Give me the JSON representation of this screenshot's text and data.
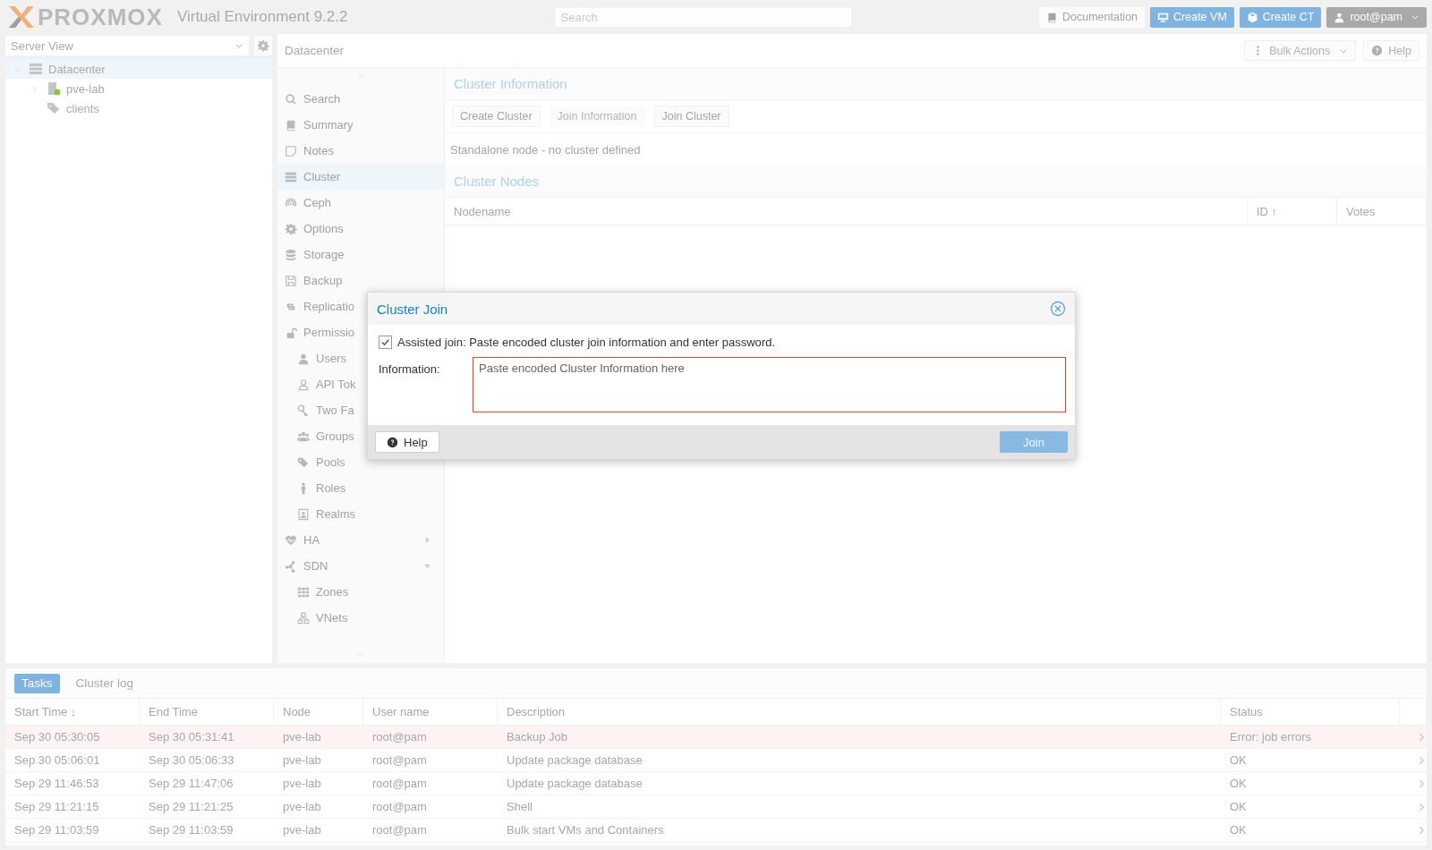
{
  "topbar": {
    "logo": "PROXMOX",
    "version": "Virtual Environment 9.2.2",
    "search": {
      "placeholder": "Search"
    },
    "buttons": [
      {
        "label": "Documentation",
        "kind": "plain"
      },
      {
        "label": "Create VM",
        "kind": "primary"
      },
      {
        "label": "Create CT",
        "kind": "primary"
      },
      {
        "label": "root@pam",
        "kind": "user"
      }
    ]
  },
  "sidebar": {
    "view_selector": "Server View",
    "tree": [
      {
        "label": "Datacenter",
        "selected": true,
        "expanded": true,
        "children": [
          {
            "label": "pve-lab",
            "selected": false,
            "expanded": false
          },
          {
            "label": "clients",
            "selected": false
          }
        ]
      }
    ]
  },
  "content": {
    "title": "Datacenter",
    "header_buttons": [
      {
        "label": "Bulk Actions",
        "menu": true
      },
      {
        "label": "Help",
        "menu": false
      }
    ],
    "nav": [
      {
        "label": "Search",
        "selected": false
      },
      {
        "label": "Summary",
        "selected": false
      },
      {
        "label": "Notes",
        "selected": false
      },
      {
        "label": "Cluster",
        "selected": true
      },
      {
        "label": "Ceph",
        "selected": false
      },
      {
        "label": "Options",
        "selected": false
      },
      {
        "label": "Storage",
        "selected": false
      },
      {
        "label": "Backup",
        "selected": false
      },
      {
        "label": "Replicatio",
        "selected": false
      },
      {
        "label": "Permissio",
        "selected": false,
        "children": [
          {
            "label": "Users",
            "selected": false
          },
          {
            "label": "API Tok",
            "selected": false
          },
          {
            "label": "Two Fa",
            "selected": false
          },
          {
            "label": "Groups",
            "selected": false
          },
          {
            "label": "Pools",
            "selected": false
          },
          {
            "label": "Roles",
            "selected": false
          },
          {
            "label": "Realms",
            "selected": false
          }
        ]
      },
      {
        "label": "HA",
        "selected": false,
        "expanded": false
      },
      {
        "label": "SDN",
        "selected": false,
        "expanded": true,
        "children": [
          {
            "label": "Zones",
            "selected": false
          },
          {
            "label": "VNets",
            "selected": false
          }
        ]
      }
    ],
    "cluster_information": {
      "title": "Cluster Information",
      "buttons": [
        {
          "label": "Create Cluster",
          "disabled": false
        },
        {
          "label": "Join Information",
          "disabled": true
        },
        {
          "label": "Join Cluster",
          "disabled": false
        }
      ],
      "status": "Standalone node - no cluster defined"
    },
    "cluster_nodes": {
      "title": "Cluster Nodes",
      "columns": [
        "Nodename",
        "ID ↑",
        "Votes"
      ]
    }
  },
  "dialog": {
    "title": "Cluster Join",
    "assisted_join": {
      "label": "Assisted join: Paste encoded cluster join information and enter password.",
      "checked": true
    },
    "information": {
      "label": "Information:",
      "placeholder": "Paste encoded Cluster Information here",
      "invalid": true
    },
    "help_button": "Help",
    "join_button": {
      "label": "Join",
      "disabled": true
    }
  },
  "tasks": {
    "tabs": [
      {
        "label": "Tasks",
        "selected": true
      },
      {
        "label": "Cluster log",
        "selected": false
      }
    ],
    "columns": [
      "Start Time ↓",
      "End Time",
      "Node",
      "User name",
      "Description",
      "Status"
    ],
    "rows": [
      {
        "cells": [
          "Sep 30 05:30:05",
          "Sep 30 05:31:41",
          "pve-lab",
          "root@pam",
          "Backup Job",
          "Error: job errors"
        ],
        "error": true
      },
      {
        "cells": [
          "Sep 30 05:06:01",
          "Sep 30 05:06:33",
          "pve-lab",
          "root@pam",
          "Update package database",
          "OK"
        ],
        "error": false
      },
      {
        "cells": [
          "Sep 29 11:46:53",
          "Sep 29 11:47:06",
          "pve-lab",
          "root@pam",
          "Update package database",
          "OK"
        ],
        "error": false
      },
      {
        "cells": [
          "Sep 29 11:21:15",
          "Sep 29 11:21:25",
          "pve-lab",
          "root@pam",
          "Shell",
          "OK"
        ],
        "error": false
      },
      {
        "cells": [
          "Sep 29 11:03:59",
          "Sep 29 11:03:59",
          "pve-lab",
          "root@pam",
          "Bulk start VMs and Containers",
          "OK"
        ],
        "error": false
      }
    ]
  }
}
